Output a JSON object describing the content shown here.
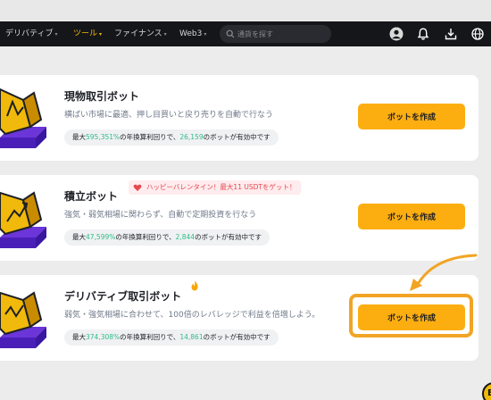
{
  "nav": {
    "items": [
      {
        "label": "デリバティブ",
        "caret": "▾"
      },
      {
        "label": "ツール",
        "caret": "▾"
      },
      {
        "label": "ファイナンス",
        "caret": "▾"
      },
      {
        "label": "Web3",
        "caret": "▾"
      }
    ],
    "active_index": 1,
    "search_placeholder": "通貨を探す",
    "icons": [
      "avatar-icon",
      "bell-icon",
      "download-icon",
      "globe-icon"
    ]
  },
  "cards": [
    {
      "title": "現物取引ボット",
      "description": "横ばい市場に最適、押し目買いと戻り売りを自動で行なう",
      "stat": {
        "prefix": "最大",
        "rate": "595,351%",
        "mid": "の年換算利回りで、",
        "count": "26,159",
        "suffix": "のボットが有効中です"
      },
      "button": "ボットを作成"
    },
    {
      "title": "積立ボット",
      "promo": "ハッピーバレンタイン！最大11 USDTをゲット！",
      "description": "強気・弱気相場に関わらず、自動で定期投資を行なう",
      "stat": {
        "prefix": "最大",
        "rate": "47,599%",
        "mid": "の年換算利回りで、",
        "count": "2,844",
        "suffix": "のボットが有効中です"
      },
      "button": "ボットを作成"
    },
    {
      "title": "デリバティブ取引ボット",
      "description": "弱気・強気相場に合わせて、100倍のレバレッジで利益を倍増しよう。",
      "stat": {
        "prefix": "最大",
        "rate": "374,308%",
        "mid": "の年換算利回りで、",
        "count": "14,861",
        "suffix": "のボットが有効中です"
      },
      "button": "ボットを作成"
    }
  ],
  "float_button": "B",
  "colors": {
    "accent": "#fcae11",
    "positive": "#2ebd85",
    "topbar": "#15161a",
    "highlight": "#f2a425",
    "promo": "#e5474d"
  }
}
